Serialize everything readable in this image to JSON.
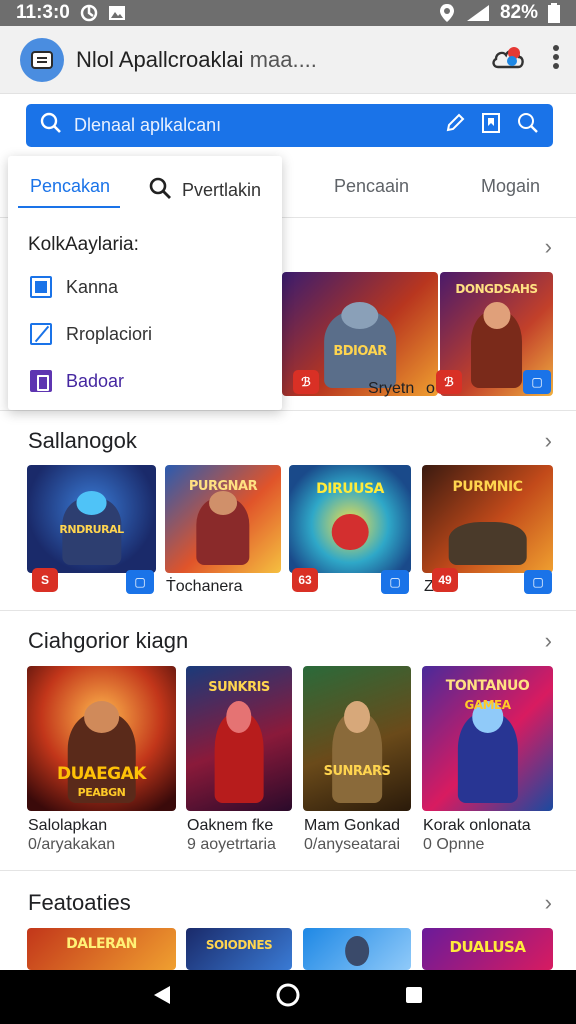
{
  "status_bar": {
    "time": "11:3:0",
    "battery": "82%"
  },
  "app_bar": {
    "title": "Nlol Apallcroaklai",
    "title_faded": "maa....",
    "logo_icon": "chat-icon"
  },
  "search": {
    "text": "Dlenaal aplkalcanı"
  },
  "tabs": [
    {
      "label": "Pencaain"
    },
    {
      "label": "Mogain"
    }
  ],
  "popup": {
    "active_tab": "Pencakan",
    "search_tab": "Pvertlakin",
    "section_label": "KolkAaylaria:",
    "options": [
      {
        "label": "Kanna"
      },
      {
        "label": "Rroplaciori"
      },
      {
        "label": "Badoar"
      }
    ]
  },
  "sections": [
    {
      "title": "",
      "tiles": [
        {
          "art_text": "BDIOAR",
          "caption": "Sryetn"
        },
        {
          "art_text": "DONGDSAHS",
          "caption": ""
        }
      ],
      "badges": {
        "red1": "ℬ",
        "red2": "ℬ"
      },
      "extra_caption": "o"
    },
    {
      "title": "Sallanogok",
      "tiles": [
        {
          "art_text": "RNDRURAL",
          "caption": ""
        },
        {
          "art_text": "PURGNAR",
          "caption": "Ṫochanera"
        },
        {
          "art_text": "DIRUUSA",
          "caption": ""
        },
        {
          "art_text": "PURMNIC",
          "caption": "Z"
        }
      ],
      "badges": [
        "S",
        "63",
        "49"
      ]
    },
    {
      "title": "Ciahgorior kiagn",
      "tiles": [
        {
          "art_text": "DUAEGAK",
          "sub_art": "PEABGN",
          "caption": "Salolapkan",
          "sub": "0/aryakakan"
        },
        {
          "art_text": "SUNKRIS",
          "caption": "Oaknem fke",
          "sub": "9 aoyetrtaria"
        },
        {
          "art_text": "SUNRARS",
          "caption": "Mam Gonkad",
          "sub": "0/anyseatarai"
        },
        {
          "art_text": "TONTANUO",
          "sub_art": "GAMEA",
          "caption": "Korak onlonata",
          "sub": "0 Opnne"
        }
      ]
    },
    {
      "title": "Featoaties",
      "tiles": [
        {
          "art_text": "DALERAN"
        },
        {
          "art_text": "SOIODNES"
        },
        {
          "art_text": ""
        },
        {
          "art_text": "DUALUSA"
        }
      ]
    }
  ],
  "colors": {
    "accent": "#1a73e8",
    "status_bar": "#6e6e6e",
    "badge_red": "#d93025"
  }
}
